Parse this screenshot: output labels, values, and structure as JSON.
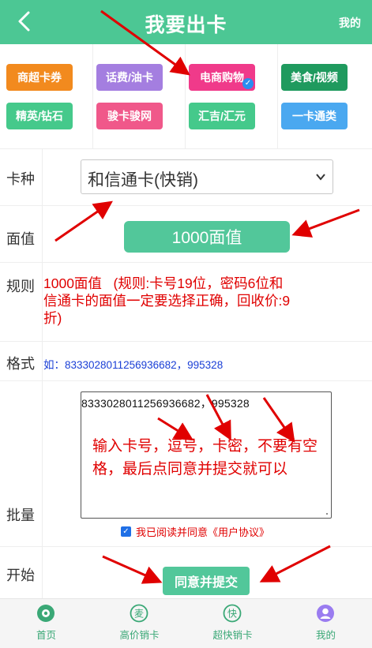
{
  "header": {
    "title": "我要出卡",
    "mine_label": "我的"
  },
  "categories": [
    {
      "label": "商超卡券",
      "color": "#f28a1e"
    },
    {
      "label": "话费/油卡",
      "color": "#a47ee0"
    },
    {
      "label": "电商购物",
      "color": "#f03a8a",
      "selected": true
    },
    {
      "label": "美食/视频",
      "color": "#1f9a5e"
    },
    {
      "label": "精英/钻石",
      "color": "#45c98b"
    },
    {
      "label": "骏卡骏网",
      "color": "#f0588a"
    },
    {
      "label": "汇吉/汇元",
      "color": "#45c98b"
    },
    {
      "label": "一卡通类",
      "color": "#4aa8f0"
    }
  ],
  "form": {
    "card_type_label": "卡种",
    "card_type_value": "和信通卡(快销)",
    "face_value_label": "面值",
    "face_value_button": "1000面值",
    "rule_label": "规则",
    "rule_text": "1000面值   (规则:卡号19位，密码6位和信通卡的面值一定要选择正确，回收价:9折)",
    "format_label": "格式",
    "format_text": "如：8333028011256936682，995328",
    "batch_label": "批量",
    "batch_value": "8333028011256936682，995328",
    "batch_annotation": "输入卡号，逗号，卡密，不要有空格，最后点同意并提交就可以",
    "agree_text": "我已阅读并同意《用户协议》",
    "start_label": "开始",
    "submit_label": "同意并提交"
  },
  "tabbar": [
    {
      "label": "首页",
      "icon": "home-icon"
    },
    {
      "label": "高价销卡",
      "icon": "sell-icon"
    },
    {
      "label": "超快销卡",
      "icon": "fast-icon"
    },
    {
      "label": "我的",
      "icon": "profile-icon"
    }
  ],
  "colors": {
    "brand": "#4cc794",
    "warning_text": "#e00000",
    "link_text": "#1a3fd6"
  }
}
